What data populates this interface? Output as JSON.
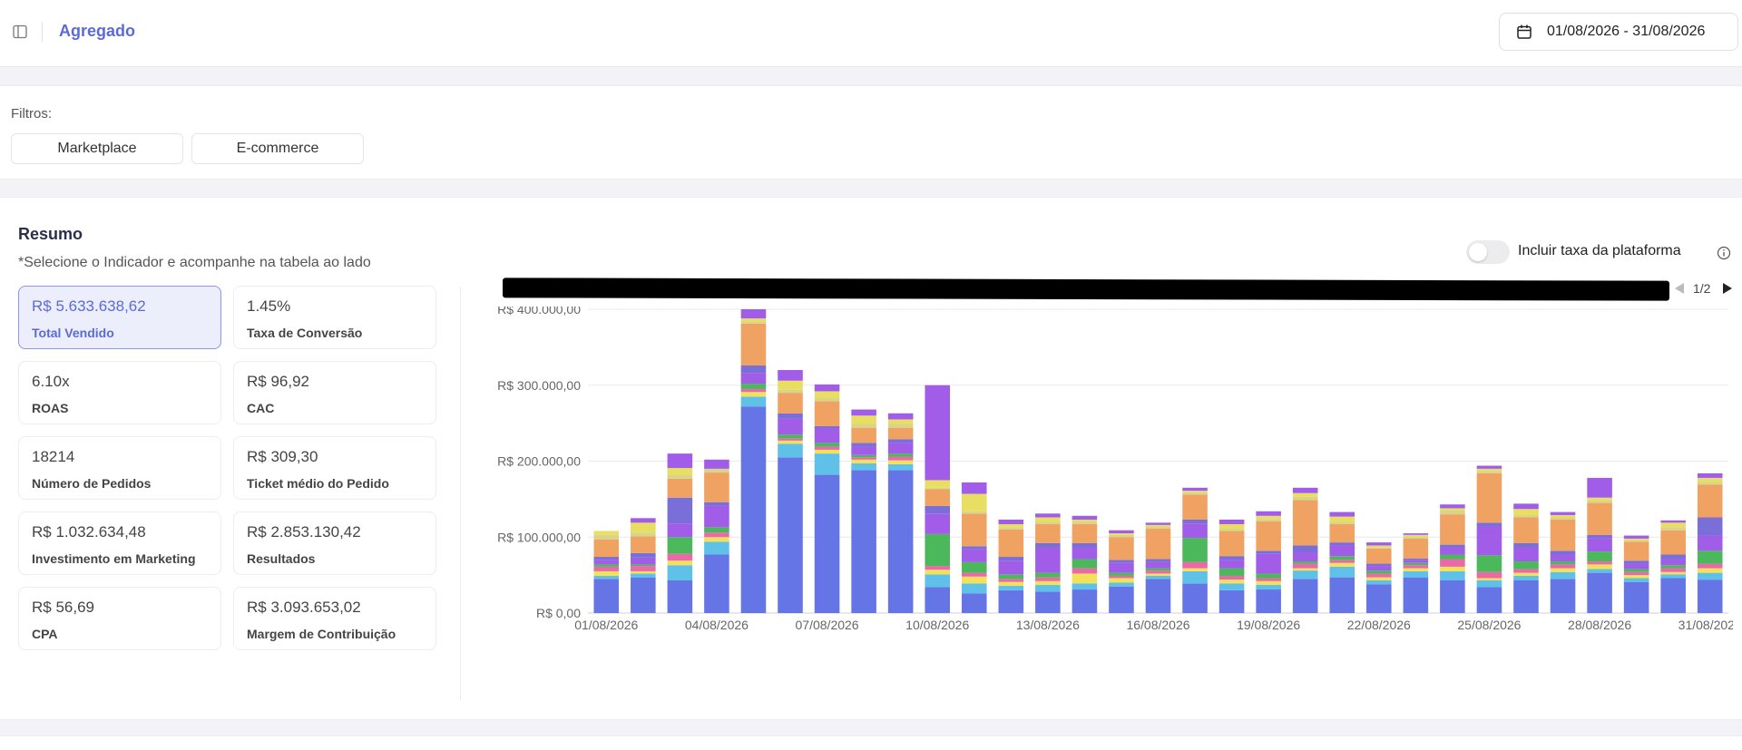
{
  "header": {
    "title": "Agregado",
    "date_range": "01/08/2026 - 31/08/2026"
  },
  "filters": {
    "label": "Filtros:",
    "buttons": [
      "Marketplace",
      "E-commerce"
    ]
  },
  "resumo": {
    "title": "Resumo",
    "subtitle": "*Selecione o Indicador e acompanhe na tabela ao lado",
    "kpis": [
      {
        "value": "R$ 5.633.638,62",
        "label": "Total Vendido",
        "active": true
      },
      {
        "value": "1.45%",
        "label": "Taxa de Conversão",
        "active": false
      },
      {
        "value": "6.10x",
        "label": "ROAS",
        "active": false
      },
      {
        "value": "R$ 96,92",
        "label": "CAC",
        "active": false
      },
      {
        "value": "18214",
        "label": "Número de Pedidos",
        "active": false
      },
      {
        "value": "R$ 309,30",
        "label": "Ticket médio do Pedido",
        "active": false
      },
      {
        "value": "R$ 1.032.634,48",
        "label": "Investimento em Marketing",
        "active": false
      },
      {
        "value": "R$ 2.853.130,42",
        "label": "Resultados",
        "active": false
      },
      {
        "value": "R$ 56,69",
        "label": "CPA",
        "active": false
      },
      {
        "value": "R$ 3.093.653,02",
        "label": "Margem de Contribuição",
        "active": false
      }
    ],
    "toggle_label": "Incluir taxa da plataforma",
    "toggle_on": false,
    "legend_page": "1/2"
  },
  "chart_data": {
    "type": "bar",
    "stacked": true,
    "ylim": [
      0,
      400000
    ],
    "ytick_values": [
      0,
      100000,
      200000,
      300000,
      400000
    ],
    "ytick_labels": [
      "R$ 0,00",
      "R$ 100.000,00",
      "R$ 200.000,00",
      "R$ 300.000,00",
      "R$ 400.000,00"
    ],
    "grid": true,
    "categories": [
      "01/08/2026",
      "02/08/2026",
      "03/08/2026",
      "04/08/2026",
      "05/08/2026",
      "06/08/2026",
      "07/08/2026",
      "08/08/2026",
      "09/08/2026",
      "10/08/2026",
      "11/08/2026",
      "12/08/2026",
      "13/08/2026",
      "14/08/2026",
      "15/08/2026",
      "16/08/2026",
      "17/08/2026",
      "18/08/2026",
      "19/08/2026",
      "20/08/2026",
      "21/08/2026",
      "22/08/2026",
      "23/08/2026",
      "24/08/2026",
      "25/08/2026",
      "26/08/2026",
      "27/08/2026",
      "28/08/2026",
      "29/08/2026",
      "30/08/2026",
      "31/08/2026"
    ],
    "xtick_labels": [
      "01/08/2026",
      "04/08/2026",
      "07/08/2026",
      "10/08/2026",
      "13/08/2026",
      "16/08/2026",
      "19/08/2026",
      "22/08/2026",
      "25/08/2026",
      "28/08/2026",
      "31/08/2026"
    ],
    "series": [
      {
        "color": "#6675e6",
        "values": [
          45000,
          47000,
          43000,
          77000,
          272000,
          205000,
          182000,
          188000,
          188000,
          34000,
          26000,
          30000,
          28000,
          31000,
          35000,
          45000,
          39000,
          30000,
          31000,
          45000,
          47000,
          38000,
          47000,
          43000,
          34000,
          43000,
          45000,
          53000,
          41000,
          46000,
          44000
        ]
      },
      {
        "color": "#5fc0e8",
        "values": [
          4000,
          5000,
          20000,
          17000,
          13000,
          18000,
          28000,
          9000,
          8000,
          17000,
          13000,
          6000,
          9000,
          8000,
          5000,
          4000,
          16000,
          9000,
          6000,
          11000,
          14000,
          5000,
          8000,
          12000,
          9000,
          6000,
          9000,
          5000,
          5000,
          5000,
          9000
        ]
      },
      {
        "color": "#f3e15a",
        "values": [
          6000,
          3000,
          6000,
          6000,
          6000,
          4000,
          5000,
          5000,
          5000,
          6000,
          9000,
          5000,
          5000,
          13000,
          6000,
          3000,
          4000,
          5000,
          5000,
          3000,
          5000,
          4000,
          4000,
          6000,
          3000,
          4000,
          5000,
          6000,
          4000,
          3000,
          6000
        ]
      },
      {
        "color": "#ea6aa8",
        "values": [
          6000,
          7000,
          9000,
          6000,
          4000,
          3000,
          4000,
          3000,
          5000,
          5000,
          5000,
          4000,
          5000,
          7000,
          3000,
          4000,
          8000,
          5000,
          4000,
          6000,
          4000,
          5000,
          4000,
          10000,
          8000,
          5000,
          5000,
          4000,
          4000,
          5000,
          6000
        ]
      },
      {
        "color": "#4cb85c",
        "values": [
          3000,
          2000,
          22000,
          7000,
          7000,
          5000,
          5000,
          3000,
          4000,
          42000,
          14000,
          6000,
          6000,
          12000,
          4000,
          3000,
          32000,
          10000,
          6000,
          3000,
          5000,
          4000,
          3000,
          6000,
          22000,
          10000,
          4000,
          13000,
          4000,
          4000,
          17000
        ]
      },
      {
        "color": "#a25de8",
        "values": [
          6000,
          9000,
          18000,
          28000,
          14000,
          21000,
          19000,
          11000,
          14000,
          27000,
          17000,
          18000,
          33000,
          15000,
          13000,
          8000,
          19000,
          11000,
          26000,
          12000,
          14000,
          6000,
          4000,
          9000,
          38000,
          18000,
          9000,
          18000,
          7000,
          8000,
          20000
        ]
      },
      {
        "color": "#7a6fd8",
        "values": [
          4000,
          6000,
          34000,
          5000,
          10000,
          7000,
          3000,
          5000,
          5000,
          10000,
          4000,
          5000,
          6000,
          6000,
          4000,
          4000,
          5000,
          5000,
          4000,
          9000,
          4000,
          3000,
          2000,
          4000,
          5000,
          6000,
          5000,
          4000,
          4000,
          6000,
          24000
        ]
      },
      {
        "color": "#f0a262",
        "values": [
          23000,
          22000,
          25000,
          39000,
          55000,
          27000,
          33000,
          20000,
          15000,
          22000,
          43000,
          36000,
          25000,
          25000,
          30000,
          40000,
          33000,
          33000,
          39000,
          60000,
          24000,
          20000,
          26000,
          40000,
          65000,
          34000,
          41000,
          42000,
          25000,
          32000,
          43000
        ]
      },
      {
        "color": "#d8d48a",
        "values": [
          6000,
          5000,
          5000,
          5000,
          3000,
          4000,
          4000,
          5000,
          5000,
          2000,
          3000,
          3000,
          3000,
          3000,
          3000,
          3000,
          3000,
          3000,
          3000,
          4000,
          3000,
          2000,
          3000,
          5000,
          3000,
          3000,
          3000,
          3000,
          2000,
          4000,
          4000
        ]
      },
      {
        "color": "#e8de62",
        "values": [
          5000,
          13000,
          9000,
          0,
          4000,
          12000,
          9000,
          11000,
          6000,
          10000,
          23000,
          4000,
          6000,
          3000,
          2000,
          2000,
          2000,
          6000,
          4000,
          5000,
          7000,
          2000,
          2000,
          3000,
          3000,
          8000,
          3000,
          4000,
          2000,
          6000,
          5000
        ]
      },
      {
        "color": "#a25de8",
        "values": [
          0,
          6000,
          19000,
          12000,
          12000,
          14000,
          9000,
          8000,
          8000,
          125000,
          15000,
          6000,
          5000,
          5000,
          4000,
          3000,
          4000,
          6000,
          6000,
          7000,
          6000,
          4000,
          2000,
          5000,
          4000,
          7000,
          4000,
          26000,
          4000,
          3000,
          6000
        ]
      }
    ]
  }
}
